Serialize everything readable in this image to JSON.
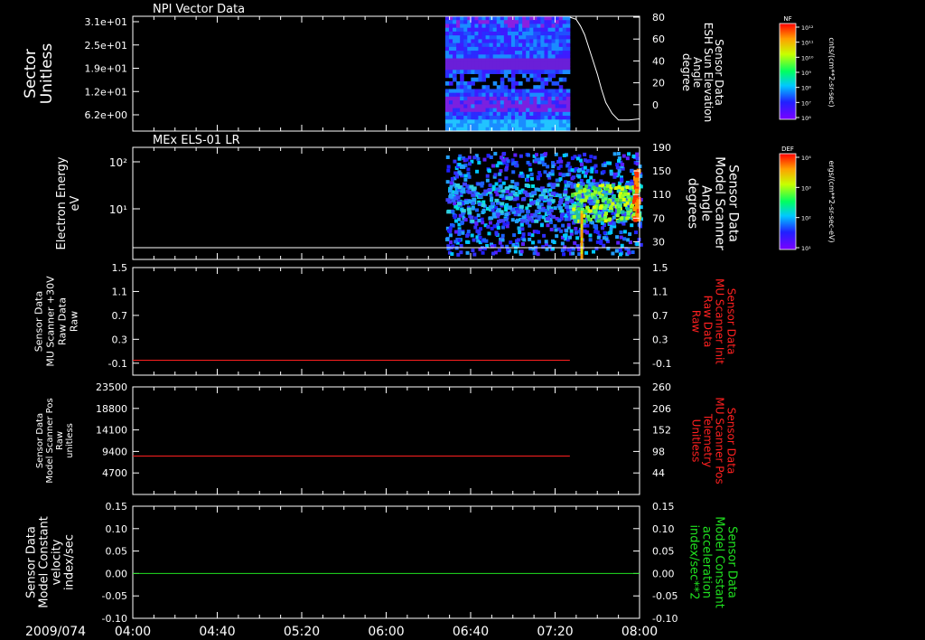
{
  "chart_data": [
    {
      "type": "heatmap",
      "title": "NPI Vector Data",
      "ylabel_left": [
        "Sector",
        "Unitless"
      ],
      "yticks_left": [
        "3.1e+01",
        "2.5e+01",
        "1.9e+01",
        "1.2e+01",
        "6.2e+00"
      ],
      "ylabel_right": [
        "Sensor Data",
        "ESH Sun Elevation",
        "Angle",
        "degree"
      ],
      "yticks_right": [
        "80",
        "60",
        "40",
        "20",
        "0"
      ],
      "ylim_right": [
        -20,
        80
      ],
      "line_series": {
        "color": "#ffffff",
        "x": [
          "07:27",
          "07:30",
          "07:32",
          "07:34",
          "07:36",
          "07:38",
          "07:40",
          "07:42",
          "07:44",
          "07:47",
          "07:50",
          "07:55",
          "08:00"
        ],
        "y": [
          80,
          78,
          72,
          64,
          52,
          40,
          28,
          14,
          2,
          -8,
          -14,
          -14,
          -13
        ]
      },
      "data_time_range": [
        "06:28",
        "07:27"
      ],
      "colorbar": {
        "label": "NF",
        "units": "cnts/(cm**2-sr-sec)",
        "ticks": [
          "10¹²",
          "10¹¹",
          "10¹⁰",
          "10⁹",
          "10⁸",
          "10⁷",
          "10⁶"
        ]
      }
    },
    {
      "type": "heatmap",
      "title": "MEx ELS-01 LR",
      "ylabel_left": [
        "Electron Energy",
        "eV"
      ],
      "yticks_left": [
        "10²",
        "10¹"
      ],
      "ylabel_right": [
        "Sensor Data",
        "Model Scanner",
        "Angle",
        "degrees"
      ],
      "yticks_right": [
        "190",
        "150",
        "110",
        "70",
        "30"
      ],
      "ylim_right": [
        0,
        190
      ],
      "data_time_range": [
        "06:28",
        "08:00"
      ],
      "colorbar": {
        "label": "DEF",
        "units": "ergs/(cm**2-sr-sec-eV)",
        "ticks": [
          "10⁴",
          "10³",
          "10²",
          "10¹"
        ]
      }
    },
    {
      "type": "line",
      "ylabel_left": [
        "Sensor Data",
        "MU Scanner +30V",
        "Raw Data",
        "Raw"
      ],
      "yticks": [
        "1.5",
        "1.1",
        "0.7",
        "0.3",
        "-0.1"
      ],
      "ylim": [
        -0.3,
        1.5
      ],
      "ylabel_right": [
        "Sensor Data",
        "MU Scanner Init",
        "Raw Data",
        "Raw"
      ],
      "series": [
        {
          "color": "#ff2020",
          "x": [
            "04:00",
            "07:27"
          ],
          "y": [
            -0.05,
            -0.05
          ]
        }
      ]
    },
    {
      "type": "line",
      "ylabel_left": [
        "Sensor Data",
        "Model Scanner Pos",
        "Raw",
        "unitless"
      ],
      "yticks_left": [
        "23500",
        "18800",
        "14100",
        "9400",
        "4700"
      ],
      "ylim_left": [
        0,
        23500
      ],
      "ylabel_right": [
        "Sensor Data",
        "MU Scanner Pos",
        "Telemetry",
        "Unitless"
      ],
      "yticks_right": [
        "260",
        "206",
        "152",
        "98",
        "44"
      ],
      "ylim_right": [
        -10,
        260
      ],
      "series": [
        {
          "color": "#ff2020",
          "x": [
            "04:00",
            "07:27"
          ],
          "y": [
            8400,
            8400
          ]
        }
      ]
    },
    {
      "type": "line",
      "ylabel_left": [
        "Sensor Data",
        "Model Constant",
        "velocity",
        "index/sec"
      ],
      "yticks": [
        "0.15",
        "0.10",
        "0.05",
        "0.00",
        "-0.05",
        "-0.10"
      ],
      "ylim": [
        -0.1,
        0.15
      ],
      "ylabel_right": [
        "Sensor Data",
        "Model Constant",
        "acceleration",
        "index/sec**2"
      ],
      "series": [
        {
          "color": "#20e020",
          "x": [
            "04:00",
            "08:00"
          ],
          "y": [
            0,
            0
          ]
        }
      ]
    }
  ],
  "time_axis": {
    "date": "2009/074",
    "ticks": [
      "04:00",
      "04:40",
      "05:20",
      "06:00",
      "06:40",
      "07:20",
      "08:00"
    ]
  },
  "colors": {
    "background": "#000000",
    "axes": "#ffffff",
    "right_label_red": "#ff2020",
    "right_label_green": "#20e020"
  }
}
